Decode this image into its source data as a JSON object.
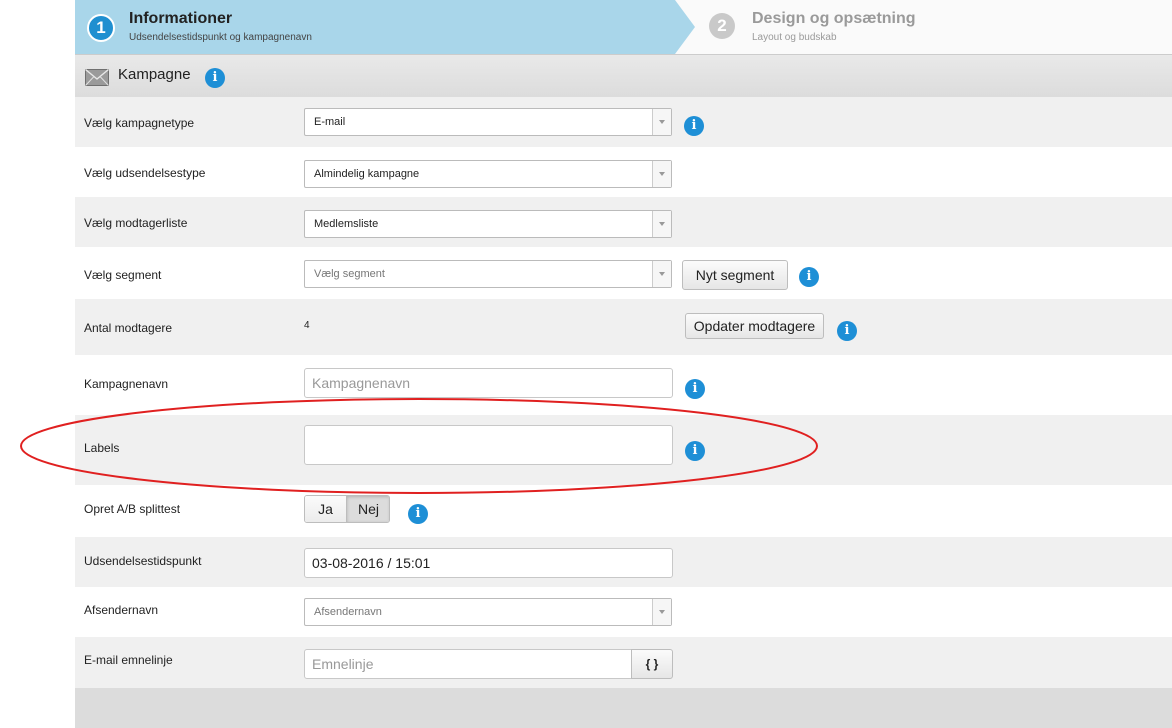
{
  "wizard": {
    "steps": [
      {
        "number": "1",
        "title": "Informationer",
        "subtitle": "Udsendelsestidspunkt og kampagnenavn"
      },
      {
        "number": "2",
        "title": "Design og opsætning",
        "subtitle": "Layout og budskab"
      }
    ]
  },
  "section": {
    "title": "Kampagne",
    "icon": "envelope-icon"
  },
  "fields": {
    "campaign_type": {
      "label": "Vælg kampagnetype",
      "value": "E-mail"
    },
    "send_type": {
      "label": "Vælg udsendelsestype",
      "value": "Almindelig kampagne"
    },
    "recipient_list": {
      "label": "Vælg modtagerliste",
      "value": "Medlemsliste"
    },
    "segment": {
      "label": "Vælg segment",
      "placeholder": "Vælg segment",
      "button": "Nyt segment"
    },
    "recipients": {
      "label": "Antal modtagere",
      "value": "4",
      "button": "Opdater modtagere"
    },
    "campaign_name": {
      "label": "Kampagnenavn",
      "placeholder": "Kampagnenavn",
      "value": ""
    },
    "labels": {
      "label": "Labels",
      "value": ""
    },
    "ab_test": {
      "label": "Opret A/B splittest",
      "yes": "Ja",
      "no": "Nej",
      "selected": "Nej"
    },
    "send_time": {
      "label": "Udsendelsestidspunkt",
      "value": "03-08-2016 / 15:01"
    },
    "sender_name": {
      "label": "Afsendernavn",
      "placeholder": "Afsendernavn"
    },
    "subject": {
      "label": "E-mail emnelinje",
      "placeholder": "Emnelinje",
      "button": "{ }"
    }
  },
  "info_glyph": "i",
  "colors": {
    "accent": "#1e8fd6",
    "wizard_active": "#a9d6ea",
    "annotation": "#e02020"
  }
}
